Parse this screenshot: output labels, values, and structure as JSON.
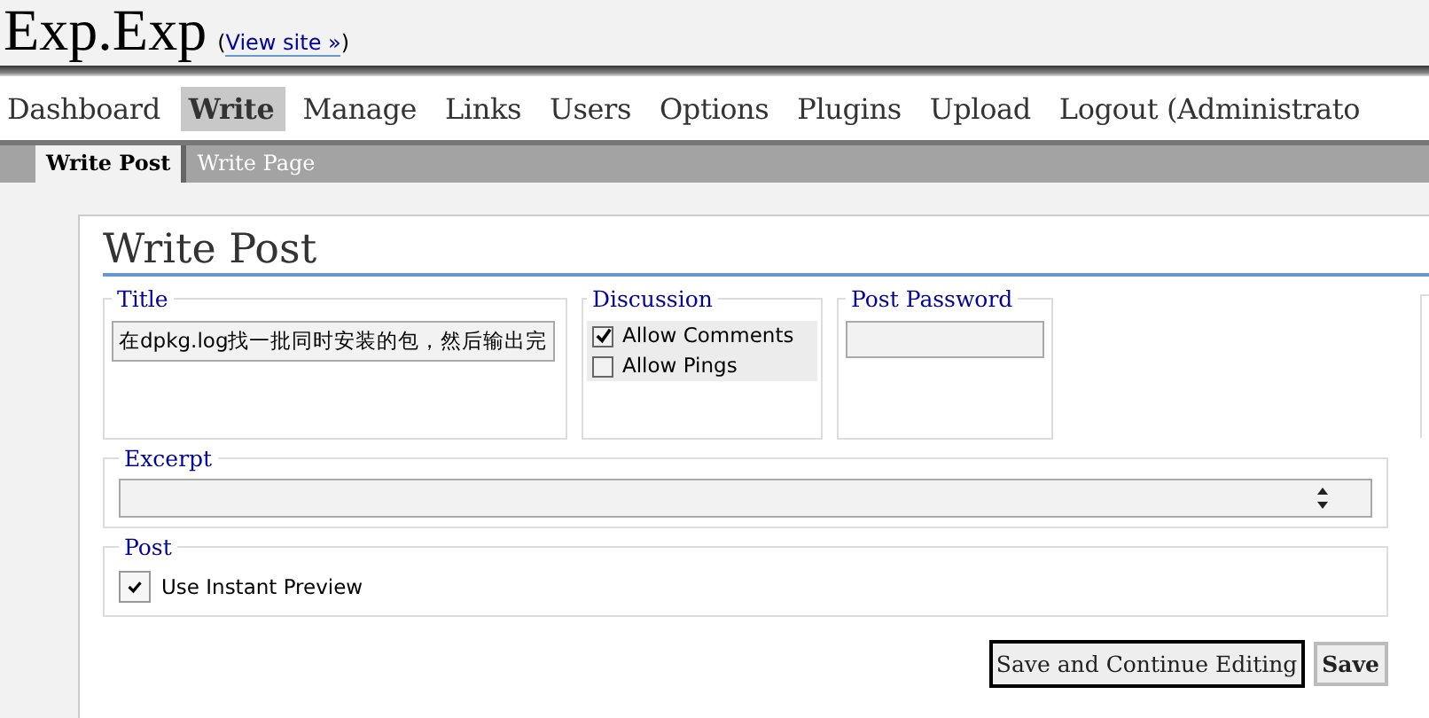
{
  "site": {
    "title": "Exp.Exp",
    "view_link": "View site »",
    "paren_open": "(",
    "paren_close": ")"
  },
  "nav": [
    {
      "label": "Dashboard",
      "selected": false
    },
    {
      "label": "Write",
      "selected": true
    },
    {
      "label": "Manage",
      "selected": false
    },
    {
      "label": "Links",
      "selected": false
    },
    {
      "label": "Users",
      "selected": false
    },
    {
      "label": "Options",
      "selected": false
    },
    {
      "label": "Plugins",
      "selected": false
    },
    {
      "label": "Upload",
      "selected": false
    },
    {
      "label": "Logout (Administrato",
      "selected": false
    }
  ],
  "subnav": [
    {
      "label": "Write Post",
      "selected": true
    },
    {
      "label": "Write Page",
      "selected": false
    }
  ],
  "page_title": "Write Post",
  "title_box": {
    "legend": "Title",
    "value": "在dpkg.log找一批同时安装的包，然后输出完"
  },
  "discussion": {
    "legend": "Discussion",
    "options": [
      {
        "label": "Allow Comments",
        "checked": true
      },
      {
        "label": "Allow Pings",
        "checked": false
      }
    ]
  },
  "password": {
    "legend": "Post Password"
  },
  "excerpt": {
    "legend": "Excerpt"
  },
  "post": {
    "legend": "Post",
    "instant_preview": {
      "label": "Use Instant Preview",
      "checked": true
    }
  },
  "buttons": [
    {
      "label": "Save and Continue Editing",
      "kind": "focused"
    },
    {
      "label": "Save",
      "kind": "primary"
    }
  ]
}
